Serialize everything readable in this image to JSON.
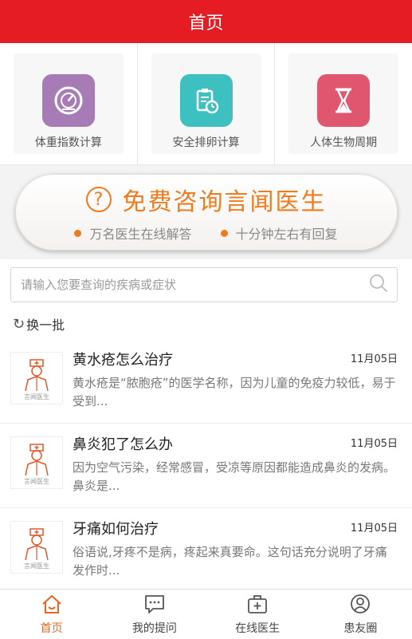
{
  "header": {
    "title": "首页"
  },
  "tools": [
    {
      "label": "体重指数计算",
      "icon": "scale-icon",
      "color": "#a77bb5"
    },
    {
      "label": "安全排卵计算",
      "icon": "clipboard-clock-icon",
      "color": "#3fc0c0"
    },
    {
      "label": "人体生物周期",
      "icon": "hourglass-icon",
      "color": "#e0566f"
    }
  ],
  "consult": {
    "title": "免费咨询言闻医生",
    "sub1": "万名医生在线解答",
    "sub2": "十分钟左右有回复",
    "accent": "#f07b1c"
  },
  "search": {
    "placeholder": "请输入您要查询的疾病或症状"
  },
  "refresh": {
    "label": "换一批"
  },
  "articles": [
    {
      "title": "黄水疮怎么治疗",
      "date": "11月05日",
      "summary": "黄水疮是“脓胞疮”的医学名称，因为儿童的免疫力较低，易于受到...",
      "thumb_caption": "言闻医生"
    },
    {
      "title": "鼻炎犯了怎么办",
      "date": "11月05日",
      "summary": "因为空气污染，经常感冒，受凉等原因都能造成鼻炎的发病。鼻炎是...",
      "thumb_caption": "言闻医生"
    },
    {
      "title": "牙痛如何治疗",
      "date": "11月05日",
      "summary": "俗语说,牙疼不是病，疼起来真要命。这句话充分说明了牙痛发作时...",
      "thumb_caption": "言闻医生"
    }
  ],
  "tabs": [
    {
      "label": "首页",
      "icon": "home-icon",
      "active": true
    },
    {
      "label": "我的提问",
      "icon": "chat-icon",
      "active": false
    },
    {
      "label": "在线医生",
      "icon": "medical-kit-icon",
      "active": false
    },
    {
      "label": "患友圈",
      "icon": "user-icon",
      "active": false
    }
  ],
  "colors": {
    "header": "#e51c23",
    "accent": "#e8641b"
  }
}
